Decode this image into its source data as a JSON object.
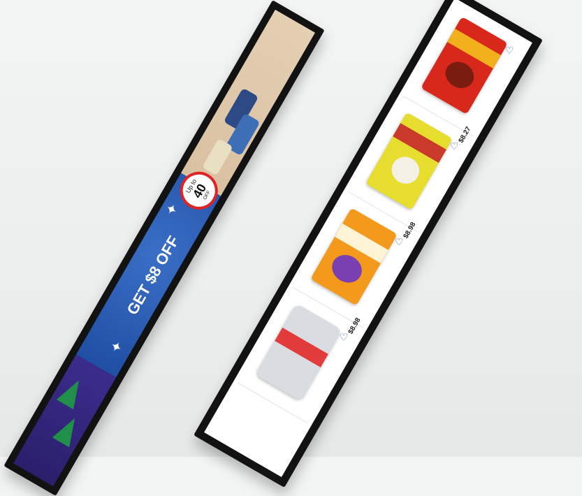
{
  "left_display": {
    "badge": {
      "line1": "Up to",
      "percent": "40",
      "line3": "OFF"
    },
    "offer_text": "GET $8 OFF"
  },
  "right_display": {
    "products": [
      {
        "price": "$8.27",
        "color": "#d8281c",
        "accent": "#f2b11c"
      },
      {
        "price": "$8.98",
        "color": "#e6dd2e",
        "accent": "#c93a2b"
      },
      {
        "price": "$8.98",
        "color": "#f39a1c",
        "accent": "#7a3fb0"
      },
      {
        "price": "",
        "color": "#d9dde2",
        "accent": "#e23b3b"
      }
    ],
    "heart_icon": "♡"
  },
  "colors": {
    "frame": "#121212",
    "blue_panel": "#2558b4",
    "beige_panel": "#dfc6a7",
    "purple_panel": "#33267b"
  }
}
